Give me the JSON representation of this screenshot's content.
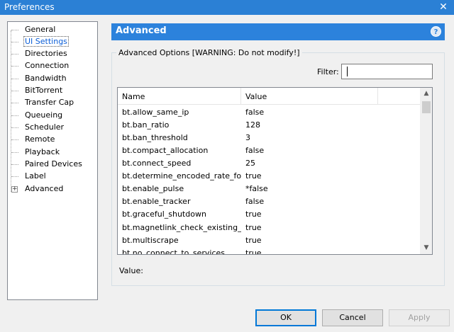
{
  "window": {
    "title": "Preferences",
    "close_glyph": "✕"
  },
  "sidebar": {
    "items": [
      {
        "label": "General"
      },
      {
        "label": "UI Settings"
      },
      {
        "label": "Directories"
      },
      {
        "label": "Connection"
      },
      {
        "label": "Bandwidth"
      },
      {
        "label": "BitTorrent"
      },
      {
        "label": "Transfer Cap"
      },
      {
        "label": "Queueing"
      },
      {
        "label": "Scheduler"
      },
      {
        "label": "Remote"
      },
      {
        "label": "Playback"
      },
      {
        "label": "Paired Devices"
      },
      {
        "label": "Label"
      },
      {
        "label": "Advanced"
      }
    ],
    "selected": "UI Settings",
    "expander_glyph": "+"
  },
  "panel": {
    "title": "Advanced",
    "help_glyph": "?",
    "group_label": "Advanced Options [WARNING: Do not modify!]",
    "filter_label": "Filter:",
    "filter_value": "",
    "value_label": "Value:"
  },
  "table": {
    "headers": {
      "name": "Name",
      "value": "Value"
    },
    "rows": [
      {
        "name": "bt.allow_same_ip",
        "value": "false"
      },
      {
        "name": "bt.ban_ratio",
        "value": "128"
      },
      {
        "name": "bt.ban_threshold",
        "value": "3"
      },
      {
        "name": "bt.compact_allocation",
        "value": "false"
      },
      {
        "name": "bt.connect_speed",
        "value": "25"
      },
      {
        "name": "bt.determine_encoded_rate_fo...",
        "value": "true"
      },
      {
        "name": "bt.enable_pulse",
        "value": "*false"
      },
      {
        "name": "bt.enable_tracker",
        "value": "false"
      },
      {
        "name": "bt.graceful_shutdown",
        "value": "true"
      },
      {
        "name": "bt.magnetlink_check_existing_...",
        "value": "true"
      },
      {
        "name": "bt.multiscrape",
        "value": "true"
      },
      {
        "name": "bt.no_connect_to_services",
        "value": "true"
      }
    ],
    "scroll_up_glyph": "▲",
    "scroll_down_glyph": "▼"
  },
  "buttons": {
    "ok": "OK",
    "cancel": "Cancel",
    "apply": "Apply"
  }
}
